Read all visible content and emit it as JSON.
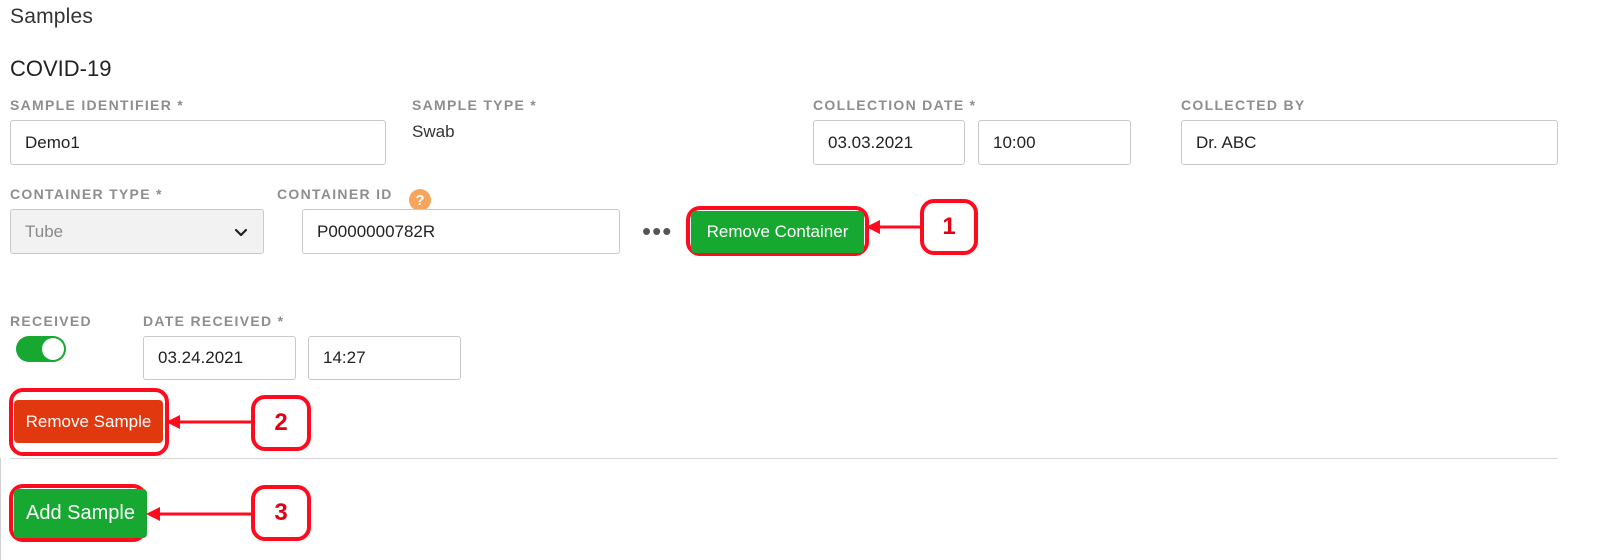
{
  "header": {
    "title": "Samples",
    "subtitle": "COVID-19"
  },
  "fields": {
    "sample_identifier": {
      "label": "SAMPLE IDENTIFIER *",
      "value": "Demo1"
    },
    "sample_type": {
      "label": "SAMPLE TYPE *",
      "value": "Swab"
    },
    "collection_date": {
      "label": "COLLECTION DATE *",
      "date": "03.03.2021",
      "time": "10:00"
    },
    "collected_by": {
      "label": "COLLECTED BY",
      "value": "Dr. ABC"
    },
    "container_type": {
      "label": "CONTAINER TYPE *",
      "value": "Tube"
    },
    "container_id": {
      "label": "CONTAINER ID",
      "value": "P0000000782R",
      "help_icon": "question-icon"
    },
    "received": {
      "label": "RECEIVED",
      "on": true
    },
    "date_received": {
      "label": "DATE RECEIVED *",
      "date": "03.24.2021",
      "time": "14:27"
    }
  },
  "buttons": {
    "more": "•••",
    "remove_container": "Remove Container",
    "remove_sample": "Remove Sample",
    "add_sample": "Add Sample"
  },
  "callouts": [
    "1",
    "2",
    "3"
  ],
  "colors": {
    "primary_green": "#16a831",
    "danger_red": "#e2380f",
    "annotation_red": "#ff0b1d",
    "help_orange": "#f7a55e"
  }
}
